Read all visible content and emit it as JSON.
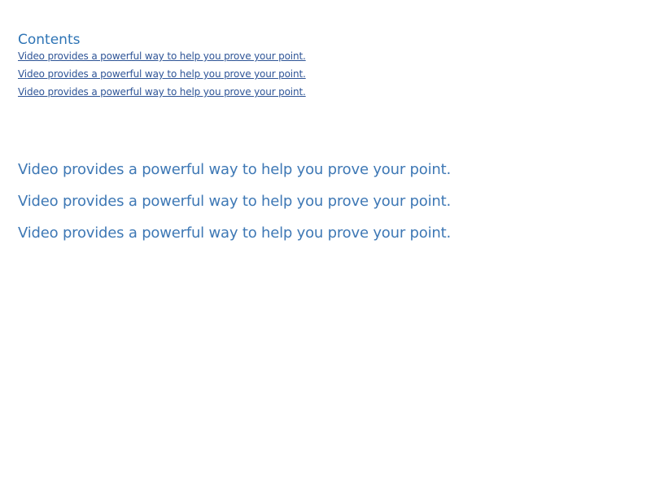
{
  "toc": {
    "heading": "Contents",
    "entries": [
      "Video provides a powerful way to help you prove your point.",
      "Video provides a powerful way to help you prove your point.",
      "Video provides a powerful way to help you prove your point."
    ]
  },
  "body": {
    "headings": [
      "Video provides a powerful way to help you prove your point.",
      "Video provides a powerful way to help you prove your point.",
      "Video provides a powerful way to help you prove your point."
    ]
  },
  "colors": {
    "heading_blue": "#2e74b5",
    "link_blue": "#2f5597"
  }
}
